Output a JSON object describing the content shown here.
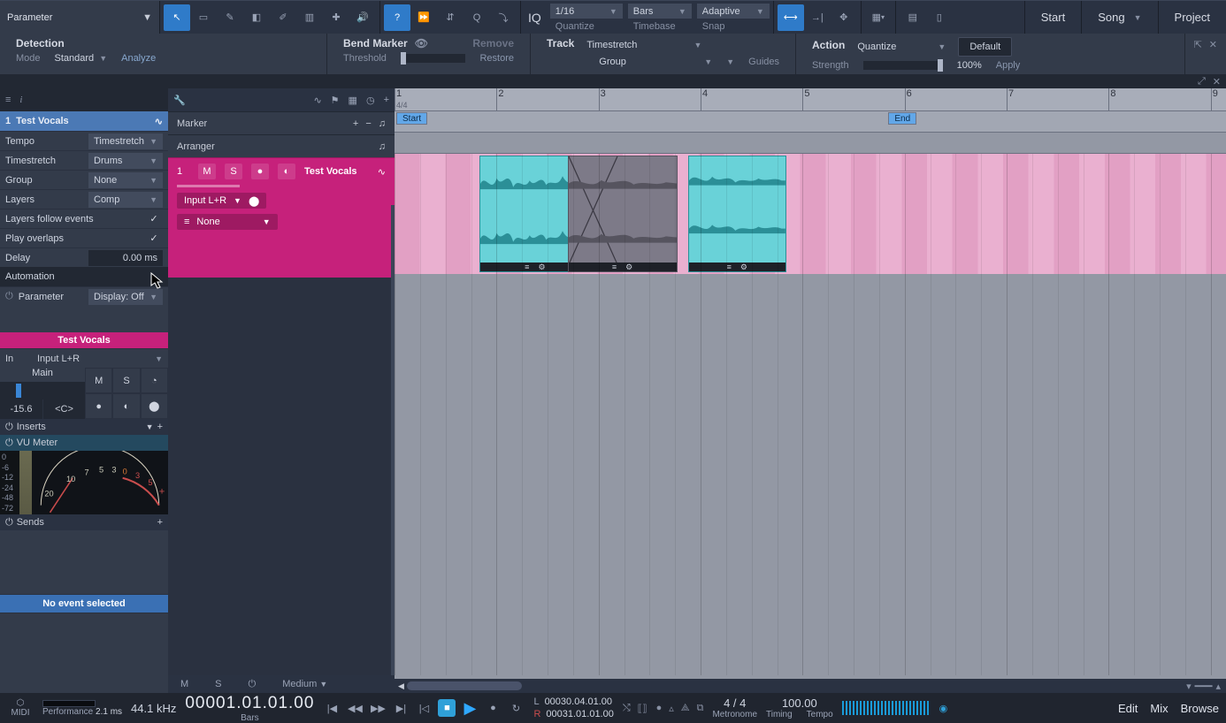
{
  "toolbar": {
    "param_label": "Parameter",
    "iq_label": "IQ",
    "quantize_val": "1/16",
    "quantize_lbl": "Quantize",
    "timebase_val": "Bars",
    "timebase_lbl": "Timebase",
    "snap_val": "Adaptive",
    "snap_lbl": "Snap"
  },
  "right_tabs": {
    "start": "Start",
    "song": "Song",
    "project": "Project"
  },
  "ctx": {
    "detection": {
      "title": "Detection",
      "mode_lbl": "Mode",
      "mode_val": "Standard",
      "analyze": "Analyze"
    },
    "bend": {
      "title": "Bend Marker",
      "threshold_lbl": "Threshold",
      "remove": "Remove",
      "restore": "Restore"
    },
    "track": {
      "title": "Track",
      "ts_val": "Timestretch",
      "group_val": "Group",
      "guides_lbl": "Guides"
    },
    "action": {
      "title": "Action",
      "qtz_val": "Quantize",
      "strength_lbl": "Strength",
      "strength_pct": "100%",
      "apply": "Apply",
      "default": "Default"
    }
  },
  "inspector": {
    "track_num": "1",
    "track_name": "Test Vocals",
    "rows": {
      "tempo_l": "Tempo",
      "tempo_r": "Timestretch",
      "ts_l": "Timestretch",
      "ts_r": "Drums",
      "group_l": "Group",
      "group_r": "None",
      "layers_l": "Layers",
      "layers_r": "Comp",
      "follow": "Layers follow events",
      "overlaps": "Play overlaps",
      "delay_l": "Delay",
      "delay_r": "0.00 ms",
      "automation": "Automation",
      "param_l": "Parameter",
      "disp_r": "Display: Off"
    },
    "mix_title": "Test Vocals",
    "in_lbl": "In",
    "in_val": "Input L+R",
    "main_lbl": "Main",
    "gain_val": "-15.6",
    "pan_val": "<C>",
    "buttons": {
      "m": "M",
      "s": "S"
    },
    "inserts": "Inserts",
    "vu_name": "VU Meter",
    "sends": "Sends",
    "vu_ticks": [
      "20",
      "10",
      "7",
      "5",
      "3",
      "0",
      "3",
      "5"
    ],
    "no_event": "No event selected"
  },
  "tracklist": {
    "marker": "Marker",
    "arranger": "Arranger",
    "vocals": {
      "num": "1",
      "m": "M",
      "s": "S",
      "name": "Test Vocals",
      "input": "Input L+R",
      "out": "None"
    },
    "bottom": {
      "m": "M",
      "s": "S",
      "auto": "Medium"
    }
  },
  "arrange": {
    "bars": [
      "1",
      "2",
      "3",
      "4",
      "5",
      "6",
      "7",
      "8",
      "9"
    ],
    "time_sig": "4/4",
    "start": "Start",
    "end": "End"
  },
  "transport": {
    "sr": "44.1 kHz",
    "perf_lbl": "Performance",
    "perf_val": "2.1 ms",
    "midi_lbl": "MIDI",
    "pos": "00001.01.01.00",
    "bars_lbl": "Bars",
    "loop_l": "L",
    "loop_l_val": "00030.04.01.00",
    "loop_r": "R",
    "loop_r_val": "00031.01.01.00",
    "sig": "4 / 4",
    "tempo": "100.00",
    "metro": "Metronome",
    "timing": "Timing",
    "tempo_lbl": "Tempo",
    "edit": "Edit",
    "mix": "Mix",
    "browse": "Browse"
  }
}
